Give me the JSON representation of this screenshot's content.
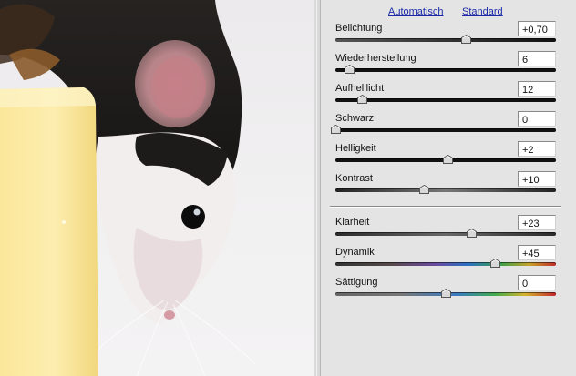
{
  "photo": {
    "description_icon": "mouse-photo-icon"
  },
  "links": {
    "auto": "Automatisch",
    "standard": "Standard"
  },
  "sliders": [
    {
      "key": "belichtung",
      "label": "Belichtung",
      "value": "+0,70",
      "position": 0.59
    },
    {
      "key": "wiederherstellung",
      "label": "Wiederherstellung",
      "value": "6",
      "position": 0.06
    },
    {
      "key": "aufhelllicht",
      "label": "Aufhelllicht",
      "value": "12",
      "position": 0.12
    },
    {
      "key": "schwarz",
      "label": "Schwarz",
      "value": "0",
      "position": 0.0
    },
    {
      "key": "helligkeit",
      "label": "Helligkeit",
      "value": "+2",
      "position": 0.51
    },
    {
      "key": "kontrast",
      "label": "Kontrast",
      "value": "+10",
      "position": 0.4
    },
    {
      "key": "klarheit",
      "label": "Klarheit",
      "value": "+23",
      "position": 0.615
    },
    {
      "key": "dynamik",
      "label": "Dynamik",
      "value": "+45",
      "position": 0.725
    },
    {
      "key": "saettigung",
      "label": "Sättigung",
      "value": "0",
      "position": 0.5
    }
  ],
  "colors": {
    "panel_bg": "#e4e4e4",
    "link": "#1c2aa8"
  }
}
